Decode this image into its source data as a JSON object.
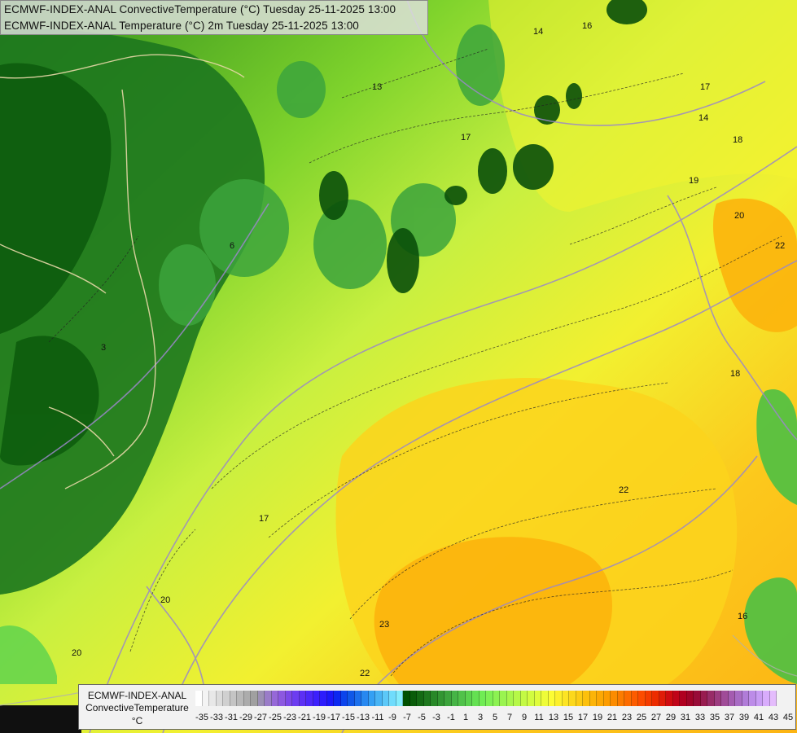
{
  "header": {
    "line1": "ECMWF-INDEX-ANAL ConvectiveTemperature (°C) Tuesday 25-11-2025 13:00",
    "line2": "ECMWF-INDEX-ANAL Temperature (°C) 2m Tuesday 25-11-2025 13:00"
  },
  "legend": {
    "name_line1": "ECMWF-INDEX-ANAL",
    "name_line2": "ConvectiveTemperature",
    "unit": "°C",
    "tick_labels": [
      "-35",
      "-33",
      "-31",
      "-29",
      "-27",
      "-25",
      "-23",
      "-21",
      "-19",
      "-17",
      "-15",
      "-13",
      "-11",
      "-9",
      "-7",
      "-5",
      "-3",
      "-1",
      "1",
      "3",
      "5",
      "7",
      "9",
      "11",
      "13",
      "15",
      "17",
      "19",
      "21",
      "23",
      "25",
      "27",
      "29",
      "31",
      "33",
      "35",
      "37",
      "39",
      "41",
      "43",
      "45"
    ],
    "colors": [
      "#ffffff",
      "#f4f4f4",
      "#e8e8e8",
      "#dcdcdc",
      "#d0d0d0",
      "#c4c4c4",
      "#b8b8b8",
      "#acacac",
      "#a0a0a0",
      "#9c90b4",
      "#9a7cc8",
      "#9668d8",
      "#8c58e0",
      "#7c48e8",
      "#6c3cf0",
      "#5c30f4",
      "#4c28f8",
      "#3c20fc",
      "#2c1cfc",
      "#1c18f8",
      "#0c28f0",
      "#0c44ec",
      "#1058e8",
      "#1c70ec",
      "#2888f0",
      "#34a0f4",
      "#48b4f4",
      "#5cc8f8",
      "#70dcfc",
      "#84ecfc",
      "#005000",
      "#0a5c0a",
      "#146a14",
      "#1e781e",
      "#288828",
      "#329632",
      "#3ca43c",
      "#46b446",
      "#50c24a",
      "#5ad24e",
      "#64e052",
      "#70ec54",
      "#7ef054",
      "#8cf252",
      "#9af450",
      "#a8f64c",
      "#b6f848",
      "#c4fa44",
      "#d2fc40",
      "#e0fc3c",
      "#eefc38",
      "#fcfc34",
      "#fcf02c",
      "#fce424",
      "#fcd81c",
      "#fccc14",
      "#fcc00c",
      "#fcb408",
      "#fca804",
      "#fc9c00",
      "#fc8c00",
      "#fc7c00",
      "#fc6c00",
      "#fc5c00",
      "#fc4c00",
      "#f43c00",
      "#ec2c00",
      "#e01c08",
      "#d00c10",
      "#c00418",
      "#b00020",
      "#a00428",
      "#980c38",
      "#981c50",
      "#982c68",
      "#9c3c80",
      "#a04c98",
      "#a45cb0",
      "#a86cc4",
      "#b07cd8",
      "#bc8ce8",
      "#c89cf4",
      "#d8acfc",
      "#e4bcfc"
    ]
  }
}
